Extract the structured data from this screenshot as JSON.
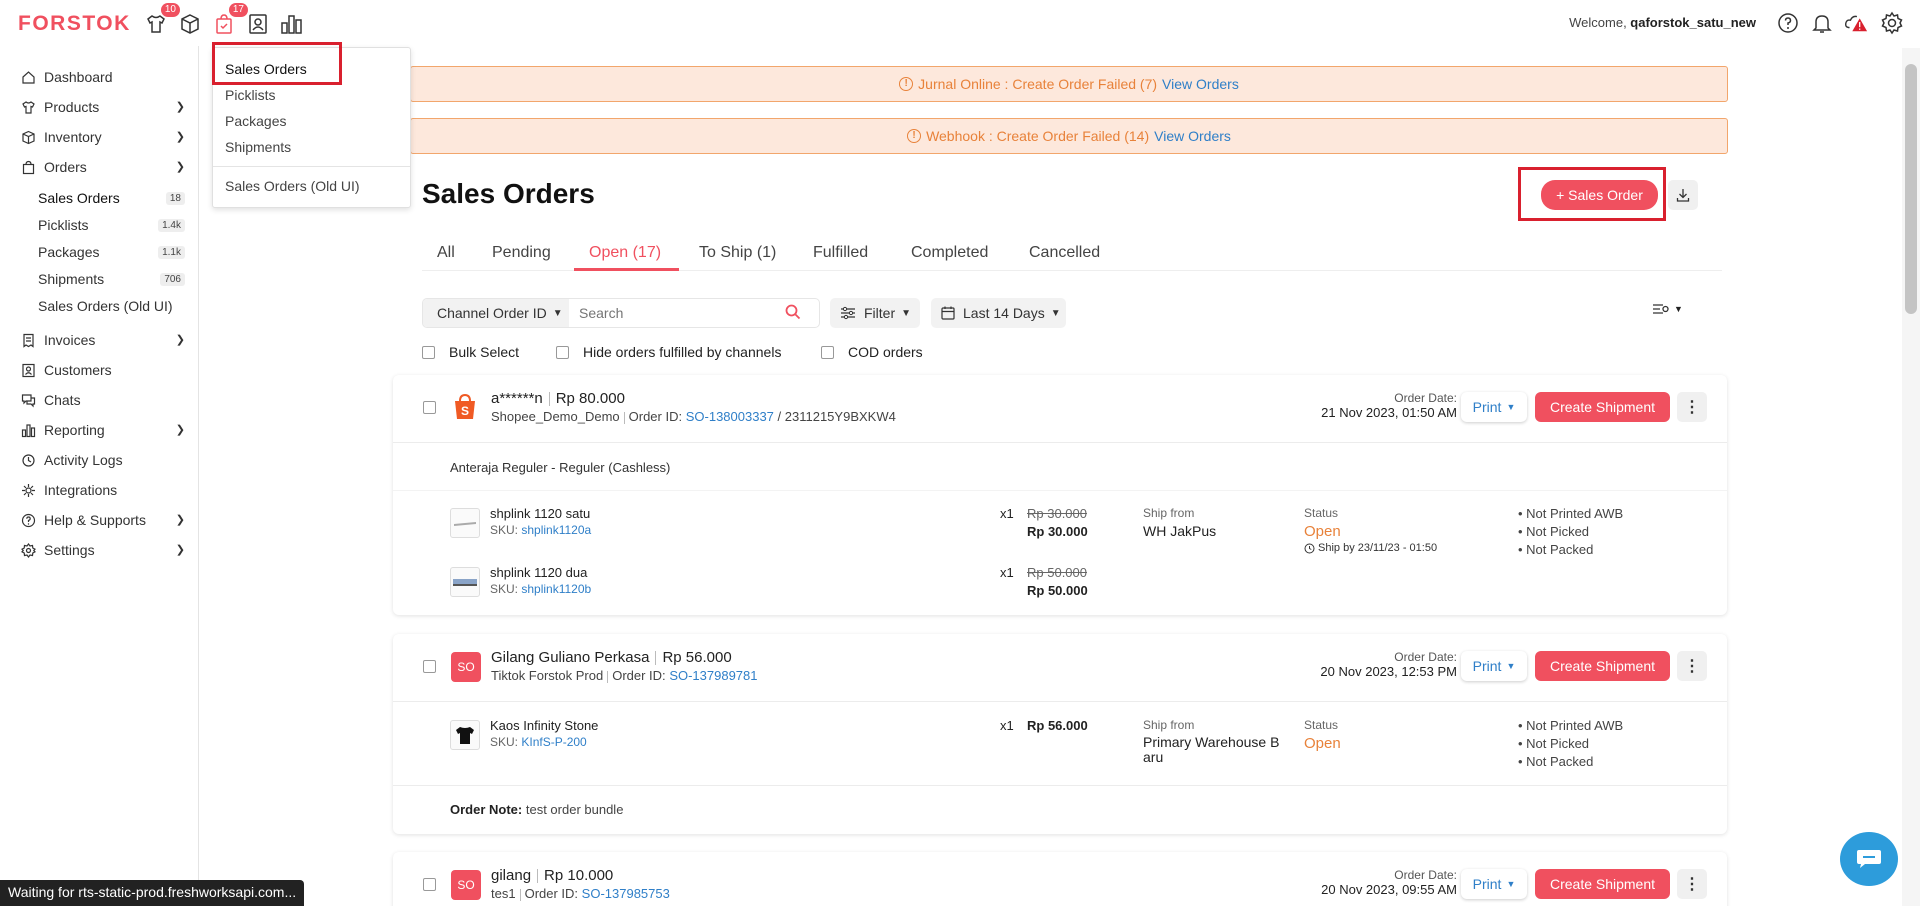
{
  "app": {
    "logo": "FORSTOK",
    "badges": {
      "products": "10",
      "orders": "17"
    },
    "welcome_prefix": "Welcome, ",
    "username": "qaforstok_satu_new"
  },
  "sidebar": {
    "dashboard": "Dashboard",
    "products": "Products",
    "inventory": "Inventory",
    "orders": "Orders",
    "sub": [
      {
        "label": "Sales Orders",
        "count": "18"
      },
      {
        "label": "Picklists",
        "count": "1.4k"
      },
      {
        "label": "Packages",
        "count": "1.1k"
      },
      {
        "label": "Shipments",
        "count": "706"
      },
      {
        "label": "Sales Orders (Old UI)",
        "count": ""
      }
    ],
    "invoices": "Invoices",
    "customers": "Customers",
    "chats": "Chats",
    "reporting": "Reporting",
    "activity_logs": "Activity Logs",
    "integrations": "Integrations",
    "help": "Help & Supports",
    "settings": "Settings"
  },
  "dropdown": {
    "items": [
      "Sales Orders",
      "Picklists",
      "Packages",
      "Shipments"
    ],
    "old_ui": "Sales Orders (Old UI)"
  },
  "banners": [
    {
      "text": "Jurnal Online : Create Order Failed (7)",
      "link": "View Orders"
    },
    {
      "text": "Webhook : Create Order Failed (14)",
      "link": "View Orders"
    }
  ],
  "page": {
    "title": "Sales Orders",
    "new_button": "+ Sales Order"
  },
  "tabs": [
    "All",
    "Pending",
    "Open (17)",
    "To Ship (1)",
    "Fulfilled",
    "Completed",
    "Cancelled"
  ],
  "filters": {
    "search_by": "Channel Order ID",
    "search_placeholder": "Search",
    "filter": "Filter",
    "date_range": "Last 14 Days"
  },
  "checks": {
    "bulk": "Bulk Select",
    "hide": "Hide orders fulfilled by channels",
    "cod": "COD orders"
  },
  "orders": [
    {
      "customer": "a******n",
      "total": "Rp 80.000",
      "store": "Shopee_Demo_Demo",
      "order_id_label": "Order ID:",
      "order_id": "SO-138003337",
      "channel_id": "/ 2311215Y9BXKW4",
      "date_label": "Order Date:",
      "date": "21 Nov 2023, 01:50 AM",
      "print": "Print",
      "create": "Create Shipment",
      "shipping": "Anteraja Reguler - Reguler (Cashless)",
      "items": [
        {
          "name": "shplink 1120 satu",
          "sku_label": "SKU:",
          "sku": "shplink1120a",
          "qty": "x1",
          "orig": "Rp 30.000",
          "price": "Rp 30.000"
        },
        {
          "name": "shplink 1120 dua",
          "sku_label": "SKU:",
          "sku": "shplink1120b",
          "qty": "x1",
          "orig": "Rp 50.000",
          "price": "Rp 50.000"
        }
      ],
      "ship_from_label": "Ship from",
      "ship_from": "WH JakPus",
      "status_label": "Status",
      "status": "Open",
      "ship_by_label": "Ship by",
      "ship_by": "23/11/23 - 01:50",
      "flags": [
        "Not Printed AWB",
        "Not Picked",
        "Not Packed"
      ]
    },
    {
      "avatar": "SO",
      "customer": "Gilang Guliano Perkasa",
      "total": "Rp 56.000",
      "store": "Tiktok Forstok Prod",
      "order_id_label": "Order ID:",
      "order_id": "SO-137989781",
      "date_label": "Order Date:",
      "date": "20 Nov 2023, 12:53 PM",
      "print": "Print",
      "create": "Create Shipment",
      "items": [
        {
          "name": "Kaos Infinity Stone",
          "sku_label": "SKU:",
          "sku": "KInfS-P-200",
          "qty": "x1",
          "price": "Rp 56.000"
        }
      ],
      "ship_from_label": "Ship from",
      "ship_from_1": "Primary Warehouse B",
      "ship_from_2": "aru",
      "status_label": "Status",
      "status": "Open",
      "flags": [
        "Not Printed AWB",
        "Not Picked",
        "Not Packed"
      ],
      "note_label": "Order Note:",
      "note": "test order bundle"
    },
    {
      "avatar": "SO",
      "customer": "gilang",
      "total": "Rp 10.000",
      "store": "tes1",
      "order_id_label": "Order ID:",
      "order_id": "SO-137985753",
      "date_label": "Order Date:",
      "date": "20 Nov 2023, 09:55 AM",
      "print": "Print",
      "create": "Create Shipment"
    }
  ],
  "statusbar": "Waiting for rts-static-prod.freshworksapi.com...",
  "colors": {
    "accent": "#f0505f",
    "link": "#2f7fc8",
    "warning": "#e8823a"
  }
}
